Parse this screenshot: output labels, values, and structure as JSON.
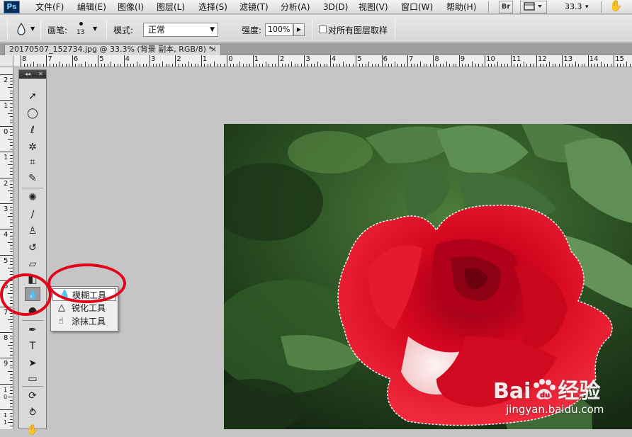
{
  "app": {
    "logo": "Ps"
  },
  "menubar": {
    "items": [
      "文件(F)",
      "编辑(E)",
      "图像(I)",
      "图层(L)",
      "选择(S)",
      "滤镜(T)",
      "分析(A)",
      "3D(D)",
      "视图(V)",
      "窗口(W)",
      "帮助(H)"
    ],
    "bridge_label": "Br",
    "zoom": "33.3",
    "zoom_caret": "▾"
  },
  "options": {
    "brush_label": "画笔:",
    "brush_size": "13",
    "mode_label": "模式:",
    "mode_value": "正常",
    "strength_label": "强度:",
    "strength_value": "100%",
    "sample_all_layers_label": "对所有图层取样"
  },
  "document": {
    "tab_title": "20170507_152734.jpg @ 33.3% (背景 副本, RGB/8) *",
    "close": "×"
  },
  "ruler": {
    "h_labels": [
      "8",
      "7",
      "6",
      "5",
      "4",
      "3",
      "2",
      "1",
      "0",
      "1",
      "2",
      "3",
      "4",
      "5",
      "6",
      "7",
      "8",
      "9",
      "10",
      "11",
      "12",
      "13",
      "14",
      "15"
    ],
    "v_labels": [
      "2",
      "1",
      "0",
      "1",
      "2",
      "3",
      "4",
      "5",
      "6",
      "7",
      "8",
      "9",
      "10",
      "11"
    ]
  },
  "toolbox": {
    "collapse": "◂◂",
    "close": "✕",
    "tools": [
      {
        "name": "move-tool",
        "glyph": "➚"
      },
      {
        "name": "marquee-tool",
        "glyph": "◯"
      },
      {
        "name": "lasso-tool",
        "glyph": "ℓ"
      },
      {
        "name": "magic-wand-tool",
        "glyph": "✲"
      },
      {
        "name": "crop-tool",
        "glyph": "⌗"
      },
      {
        "name": "eyedropper-tool",
        "glyph": "✎"
      },
      {
        "name": "spot-healing-tool",
        "glyph": "✺"
      },
      {
        "name": "brush-tool",
        "glyph": "∕"
      },
      {
        "name": "clone-stamp-tool",
        "glyph": "♙"
      },
      {
        "name": "history-brush-tool",
        "glyph": "↺"
      },
      {
        "name": "eraser-tool",
        "glyph": "▱"
      },
      {
        "name": "gradient-tool",
        "glyph": "◧"
      },
      {
        "name": "blur-tool",
        "glyph": "💧"
      },
      {
        "name": "dodge-tool",
        "glyph": "●"
      },
      {
        "name": "pen-tool",
        "glyph": "✒"
      },
      {
        "name": "type-tool",
        "glyph": "T"
      },
      {
        "name": "path-selection-tool",
        "glyph": "➤"
      },
      {
        "name": "shape-tool",
        "glyph": "▭"
      },
      {
        "name": "3d-rotate-tool",
        "glyph": "⟳"
      },
      {
        "name": "3d-orbit-tool",
        "glyph": "⥁"
      },
      {
        "name": "hand-tool",
        "glyph": "✋"
      }
    ]
  },
  "flyout": {
    "items": [
      {
        "label": "模糊工具",
        "icon": "💧"
      },
      {
        "label": "锐化工具",
        "icon": "△"
      },
      {
        "label": "涂抹工具",
        "icon": "☝"
      }
    ]
  },
  "watermark": {
    "brand": "Bai",
    "brand_tail": "经验",
    "url": "jingyan.baidu.com"
  },
  "colors": {
    "highlight_ring": "#e3001b",
    "rose": "#d8061f",
    "foliage": "#2e5a24"
  }
}
